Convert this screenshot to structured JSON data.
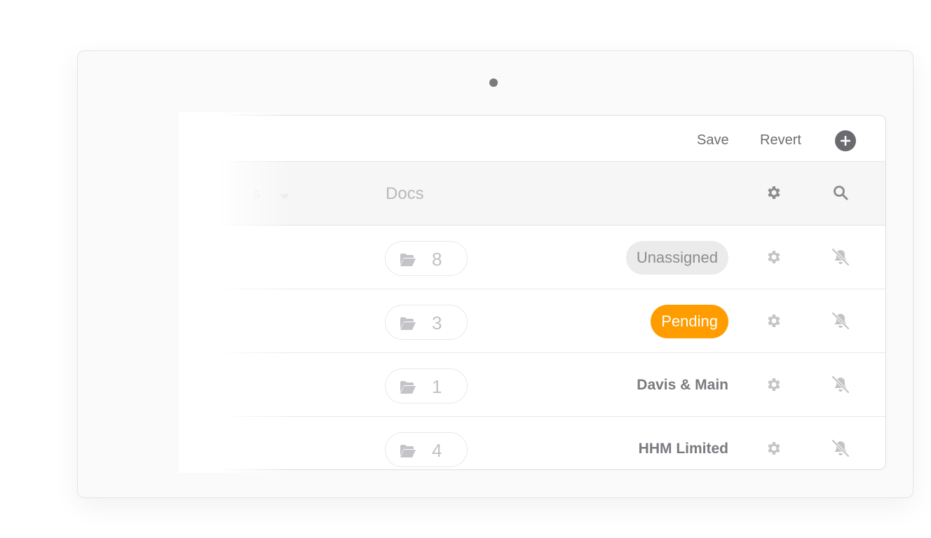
{
  "toolbar": {
    "save_label": "Save",
    "revert_label": "Revert",
    "add_icon": "plus-circle-icon"
  },
  "header": {
    "hidden_column_label": "s",
    "docs_label": "Docs",
    "settings_icon": "gear-icon",
    "search_icon": "search-icon"
  },
  "rows": [
    {
      "docs_count": "8",
      "status": "Unassigned",
      "status_style": "gray-badge"
    },
    {
      "docs_count": "3",
      "status": "Pending",
      "status_style": "orange-badge"
    },
    {
      "docs_count": "1",
      "status": "Davis & Main",
      "status_style": "plain"
    },
    {
      "docs_count": "4",
      "status": "HHM Limited",
      "status_style": "plain"
    }
  ],
  "colors": {
    "accent_orange": "#ff9d00",
    "badge_gray": "#ebebeb",
    "icon_gray": "#c4c4c8",
    "text_gray": "#6e6e73"
  }
}
